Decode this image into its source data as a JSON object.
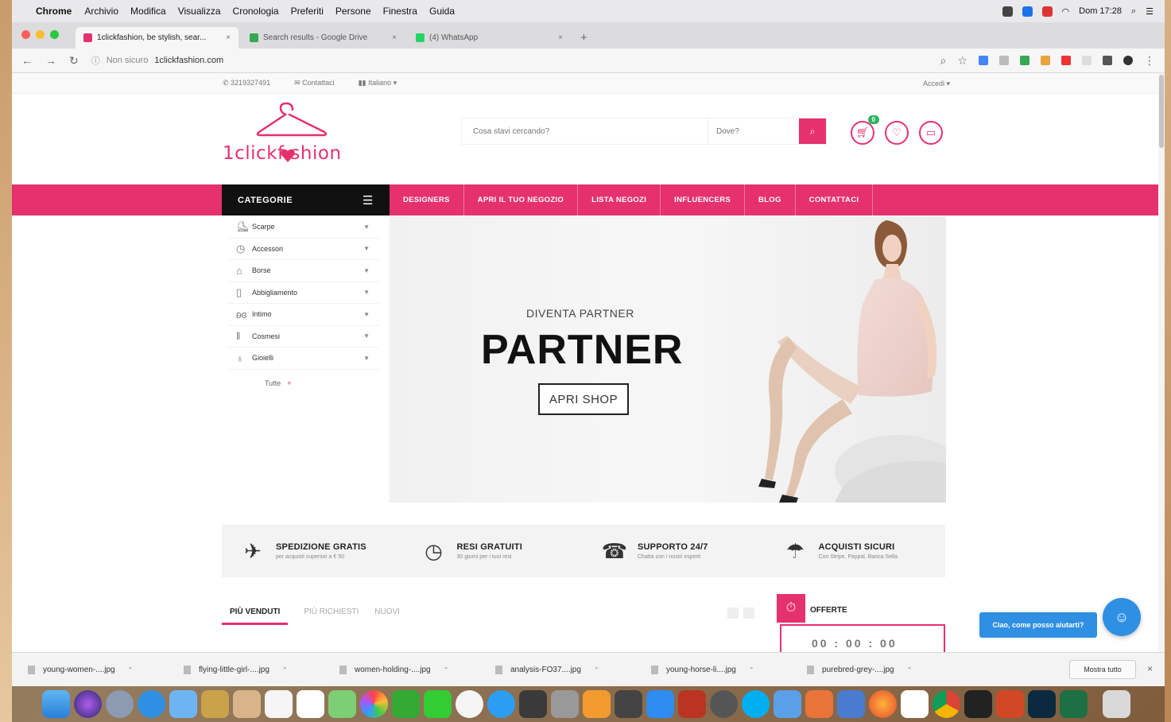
{
  "menubar": {
    "app": "Chrome",
    "items": [
      "Archivio",
      "Modifica",
      "Visualizza",
      "Cronologia",
      "Preferiti",
      "Persone",
      "Finestra",
      "Guida"
    ],
    "clock": "Dom 17:28"
  },
  "browser": {
    "tabs": [
      {
        "title": "1clickfashion, be stylish, sear...",
        "color": "#e5316d"
      },
      {
        "title": "Search results - Google Drive",
        "color": "#34a853"
      },
      {
        "title": "(4) WhatsApp",
        "color": "#25d366"
      }
    ],
    "new_tab": "+",
    "secure_label": "Non sicuro",
    "url": "1clickfashion.com"
  },
  "site": {
    "topbar": {
      "phone": "3219327491",
      "contact": "Contattaci",
      "language": "Italiano",
      "login": "Accedi"
    },
    "logo_text": "1clickf  shion",
    "search": {
      "query_placeholder": "Cosa stavi cercando?",
      "where_placeholder": "Dove?"
    },
    "cart_count": "0",
    "categories_label": "CATEGORIE",
    "menu": [
      "DESIGNERS",
      "APRI IL TUO NEGOZIO",
      "LISTA NEGOZI",
      "INFLUENCERS",
      "BLOG",
      "CONTATTACI"
    ],
    "sidebar": {
      "items": [
        "Scarpe",
        "Accessori",
        "Borse",
        "Abbigliamento",
        "Intimo",
        "Cosmesi",
        "Gioielli"
      ],
      "all_label": "Tutte",
      "all_icon": "+"
    },
    "hero": {
      "subtitle": "DIVENTA PARTNER",
      "title": "PARTNER",
      "button": "APRI SHOP"
    },
    "features": [
      {
        "title": "SPEDIZIONE GRATIS",
        "subtitle": "per acquisti superiori a € 50",
        "icon": "airplane-icon"
      },
      {
        "title": "RESI GRATUITI",
        "subtitle": "30 giorni per i tuoi resi",
        "icon": "clock-icon"
      },
      {
        "title": "SUPPORTO 24/7",
        "subtitle": "Chatta con i nostri esperti",
        "icon": "support-icon"
      },
      {
        "title": "ACQUISTI SICURI",
        "subtitle": "Con Stripe, Paypal, Banca Sella",
        "icon": "umbrella-icon"
      }
    ],
    "product_tabs": [
      "PIÙ VENDUTI",
      "PIÙ RICHIESTI",
      "NUOVI"
    ],
    "offers_label": "OFFERTE",
    "offers_timer": "00 : 00 : 00",
    "chat_bubble": "Ciao, come posso aiutarti?"
  },
  "downloads": {
    "files": [
      "young-women-....jpg",
      "flying-little-girl-....jpg",
      "women-holding-....jpg",
      "analysis-FO37....jpg",
      "young-horse-li....jpg",
      "purebred-grey-....jpg"
    ],
    "show_all": "Mostra tutto",
    "close": "×"
  },
  "colors": {
    "brand": "#e5316d",
    "dark": "#111111",
    "chat": "#2f8fe3"
  }
}
